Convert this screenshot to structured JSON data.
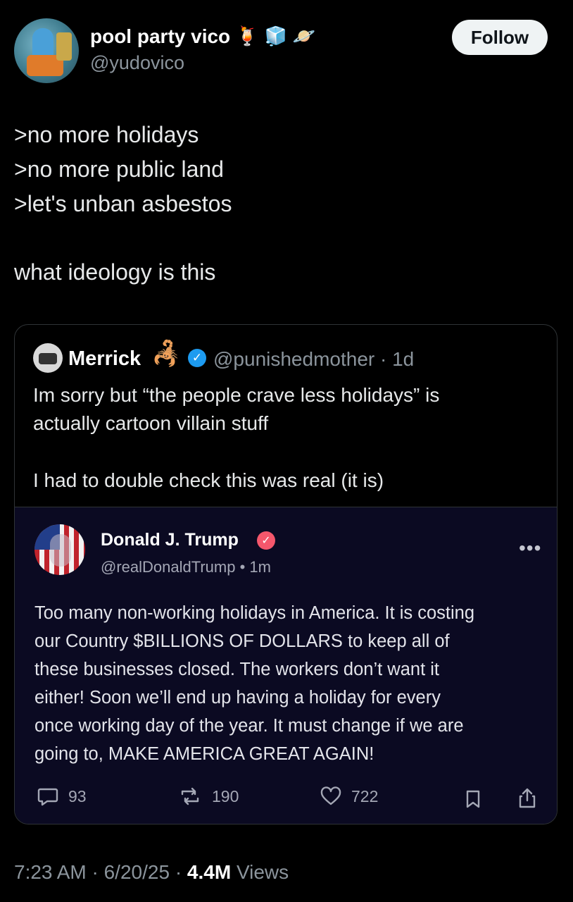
{
  "author": {
    "display_name": "pool party vico",
    "emojis": [
      "🍹",
      "🧊",
      "🪐"
    ],
    "handle": "@yudovico",
    "follow_label": "Follow"
  },
  "tweet": {
    "lines": [
      ">no more holidays",
      ">no more public land",
      ">let's unban asbestos",
      "what ideology is this"
    ]
  },
  "quote": {
    "name": "Merrick",
    "emoji": "🦂",
    "handle": "@punishedmother · 1d",
    "lines": [
      "Im sorry but “the people crave less holidays” is",
      "actually cartoon villain stuff",
      "I had to double check this was real (it is)"
    ]
  },
  "embed": {
    "name": "Donald J. Trump",
    "handle": "@realDonaldTrump • 1m",
    "more": "•••",
    "lines": [
      "Too many non-working holidays in America. It is costing",
      "our Country $BILLIONS OF DOLLARS to keep all of",
      "these businesses closed. The workers don’t want it",
      "either! Soon we’ll end up having a holiday for every",
      "once working day of the year. It must change if we are",
      "going to, MAKE AMERICA GREAT AGAIN!"
    ],
    "replies": "93",
    "reposts": "190",
    "likes": "722"
  },
  "meta": {
    "time_date": "7:23 AM · 6/20/25 · ",
    "views_count": "4.4M",
    "views_label": " Views"
  }
}
